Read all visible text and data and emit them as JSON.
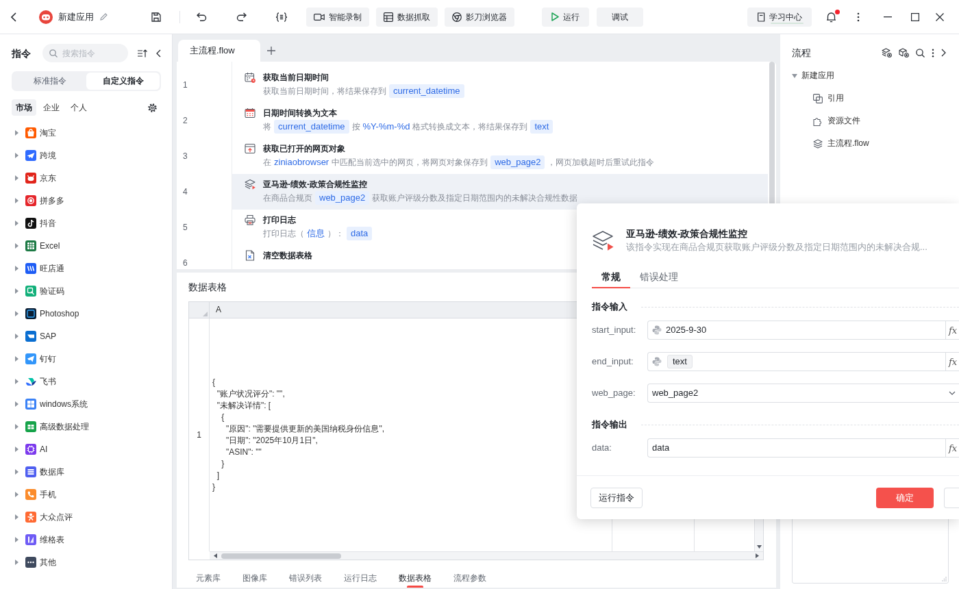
{
  "top_bar": {
    "app_name": "新建应用",
    "tools": [
      {
        "kind": "record",
        "label": "智能录制"
      },
      {
        "kind": "capture",
        "label": "数据抓取"
      },
      {
        "kind": "browser",
        "label": "影刀浏览器"
      }
    ],
    "actions": [
      {
        "kind": "run",
        "label": "运行"
      },
      {
        "kind": "debug",
        "label": "调试"
      }
    ],
    "learning_center": "学习中心",
    "notification_dot": true
  },
  "sidebar": {
    "title": "指令",
    "search": {
      "placeholder": "搜索指令"
    },
    "tabs": [
      {
        "label": "标准指令",
        "selected": false
      },
      {
        "label": "自定义指令",
        "selected": true
      }
    ],
    "scopes": [
      {
        "label": "市场",
        "selected": true
      },
      {
        "label": "企业",
        "selected": false
      },
      {
        "label": "个人",
        "selected": false
      }
    ],
    "categories": [
      {
        "label": "淘宝",
        "expanded": false
      },
      {
        "label": "跨境",
        "expanded": false
      },
      {
        "label": "京东",
        "expanded": false
      },
      {
        "label": "拼多多",
        "expanded": false
      },
      {
        "label": "抖音",
        "expanded": false
      },
      {
        "label": "Excel",
        "expanded": false
      },
      {
        "label": "旺店通",
        "expanded": false
      },
      {
        "label": "验证码",
        "expanded": false
      },
      {
        "label": "Photoshop",
        "expanded": false
      },
      {
        "label": "SAP",
        "expanded": false
      },
      {
        "label": "钉钉",
        "expanded": false
      },
      {
        "label": "飞书",
        "expanded": false
      },
      {
        "label": "windows系统",
        "expanded": false
      },
      {
        "label": "高级数据处理",
        "expanded": false
      },
      {
        "label": "AI",
        "expanded": false
      },
      {
        "label": "数据库",
        "expanded": false
      },
      {
        "label": "手机",
        "expanded": false
      },
      {
        "label": "大众点评",
        "expanded": false
      },
      {
        "label": "维格表",
        "expanded": false
      },
      {
        "label": "其他",
        "expanded": false
      }
    ]
  },
  "editor": {
    "tabs": [
      {
        "label": "主流程.flow",
        "selected": true
      }
    ],
    "steps": [
      {
        "line": "1",
        "kind": "current_time",
        "title": "获取当前日期时间",
        "selected": false,
        "description": [
          {
            "kind": "text",
            "text": "获取当前日期时间，将结果保存到"
          },
          {
            "kind": "variable",
            "text": "current_datetime"
          }
        ]
      },
      {
        "line": "2",
        "kind": "format_time",
        "title": "日期时间转换为文本",
        "selected": false,
        "description": [
          {
            "kind": "text",
            "text": "将"
          },
          {
            "kind": "variable",
            "text": "current_datetime"
          },
          {
            "kind": "text",
            "text": "按"
          },
          {
            "kind": "value",
            "text": "%Y-%m-%d"
          },
          {
            "kind": "text",
            "text": "格式转换成文本，将结果保存到"
          },
          {
            "kind": "variable",
            "text": "text"
          }
        ]
      },
      {
        "line": "3",
        "kind": "get_webpage",
        "title": "获取已打开的网页对象",
        "selected": false,
        "description": [
          {
            "kind": "text",
            "text": "在"
          },
          {
            "kind": "value",
            "text": "ziniaobrowser"
          },
          {
            "kind": "text",
            "text": "中匹配当前选中的网页，将网页对象保存到"
          },
          {
            "kind": "variable",
            "text": "web_page2"
          },
          {
            "kind": "text",
            "text": "，网页加载超时后重试此指令"
          }
        ]
      },
      {
        "line": "4",
        "kind": "custom",
        "title": "亚马逊-绩效-政策合规性监控",
        "selected": true,
        "description": [
          {
            "kind": "text",
            "text": "在商品合规页"
          },
          {
            "kind": "variable",
            "text": "web_page2"
          },
          {
            "kind": "text",
            "text": "获取账户评级分数及指定日期范围内的未解决合规性数据"
          }
        ]
      },
      {
        "line": "5",
        "kind": "print_log",
        "title": "打印日志",
        "selected": false,
        "description": [
          {
            "kind": "text",
            "text": "打印日志（"
          },
          {
            "kind": "value",
            "text": "信息"
          },
          {
            "kind": "text",
            "text": "）："
          },
          {
            "kind": "variable",
            "text": "data"
          }
        ]
      },
      {
        "line": "6",
        "kind": "clear_table",
        "title": "清空数据表格",
        "selected": false
      }
    ]
  },
  "data_panel": {
    "title": "数据表格",
    "table": {
      "columns": [
        "A"
      ],
      "rows": [
        {
          "number": "1",
          "cells": [
            "{\n  \"账户状况评分\": \"\",\n  \"未解决详情\": [\n    {\n      \"原因\": \"需要提供更新的美国纳税身份信息\",\n      \"日期\": \"2025年10月1日\",\n      \"ASIN\": \"\"\n    }\n  ]\n}"
          ]
        }
      ]
    },
    "tabs": [
      {
        "label": "元素库",
        "selected": false
      },
      {
        "label": "图像库",
        "selected": false
      },
      {
        "label": "错误列表",
        "selected": false
      },
      {
        "label": "运行日志",
        "selected": false
      },
      {
        "label": "数据表格",
        "selected": true
      },
      {
        "label": "流程参数",
        "selected": false
      }
    ]
  },
  "flow_panel": {
    "title": "流程",
    "tree": [
      {
        "label": "新建应用",
        "expanded": true,
        "children": [
          {
            "kind": "reference",
            "label": "引用"
          },
          {
            "kind": "resource",
            "label": "资源文件"
          },
          {
            "kind": "flow",
            "label": "主流程.flow"
          }
        ]
      }
    ]
  },
  "dialog": {
    "title": "亚马逊-绩效-政策合规性监控",
    "description": "该指令实现在商品合规页获取账户评级分数及指定日期范围内的未解决合规...",
    "tabs": [
      {
        "label": "常规",
        "selected": true
      },
      {
        "label": "错误处理",
        "selected": false
      }
    ],
    "sections": [
      {
        "title": "指令输入",
        "fields": [
          {
            "label": "start_input:",
            "kind": "expression",
            "value": "2025-9-30",
            "button": "fx"
          },
          {
            "label": "end_input:",
            "kind": "expression",
            "variable": "text",
            "button": "fx"
          },
          {
            "label": "web_page:",
            "kind": "select",
            "value": "web_page2"
          }
        ]
      },
      {
        "title": "指令输出",
        "fields": [
          {
            "label": "data:",
            "kind": "output",
            "value": "data",
            "button": "fx"
          }
        ]
      }
    ],
    "buttons": [
      {
        "kind": "run",
        "label": "运行指令"
      },
      {
        "kind": "confirm",
        "label": "确定"
      },
      {
        "kind": "plain"
      }
    ]
  }
}
